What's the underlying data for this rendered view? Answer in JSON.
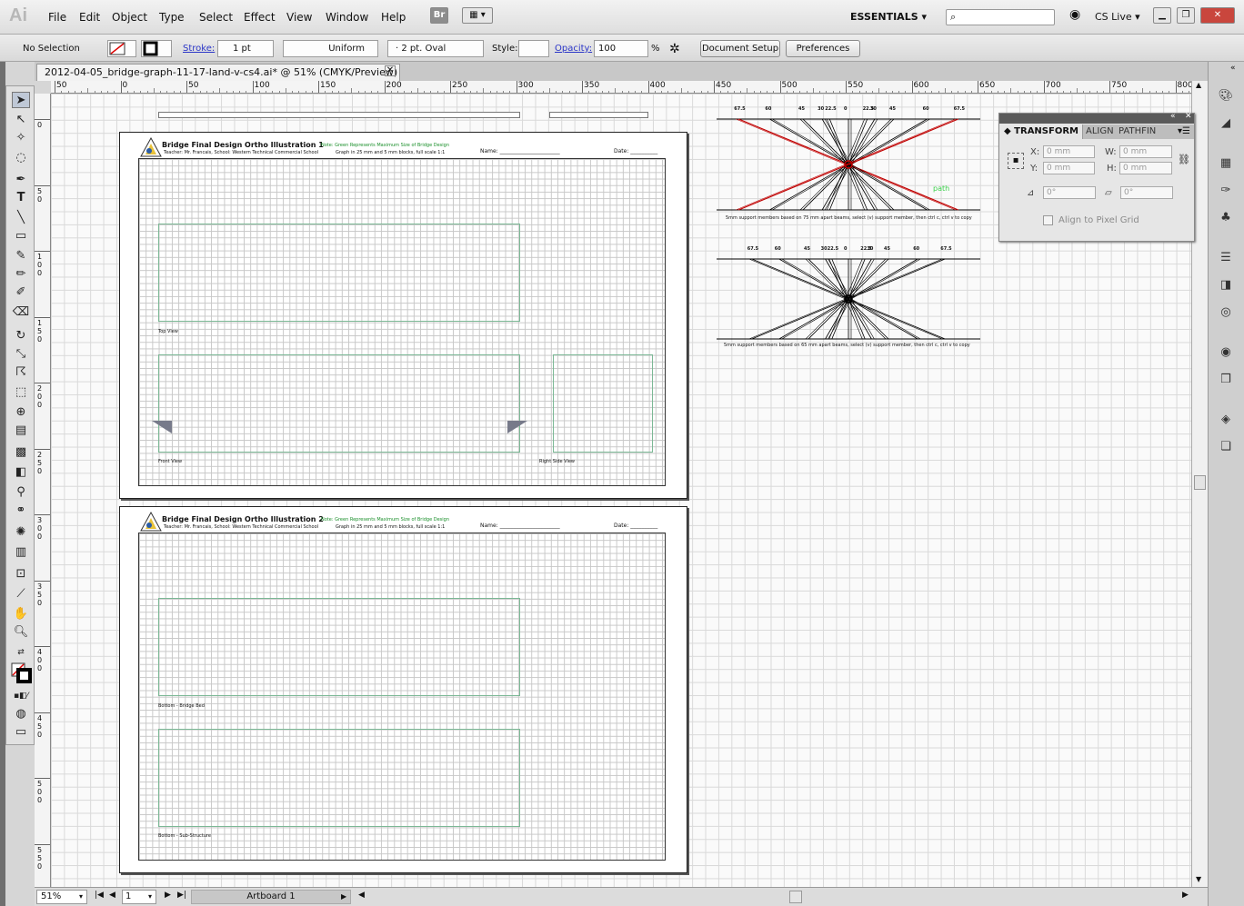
{
  "app": {
    "logo": "Ai"
  },
  "menu": {
    "items": [
      "File",
      "Edit",
      "Object",
      "Type",
      "Select",
      "Effect",
      "View",
      "Window",
      "Help"
    ],
    "bridge": "Br",
    "workspace": "ESSENTIALS",
    "cslive": "CS Live"
  },
  "control": {
    "selection": "No Selection",
    "stroke_label": "Stroke:",
    "stroke_weight": "1 pt",
    "stroke_profile": "Uniform",
    "brush": "2 pt. Oval",
    "style_label": "Style:",
    "opacity_label": "Opacity:",
    "opacity_value": "100",
    "percent": "%",
    "doc_setup": "Document Setup",
    "preferences": "Preferences"
  },
  "document": {
    "tab_title": "2012-04-05_bridge-graph-11-17-land-v-cs4.ai* @ 51% (CMYK/Preview)"
  },
  "rulers": {
    "h_ticks": [
      "50",
      "0",
      "50",
      "100",
      "150",
      "200",
      "250",
      "300",
      "350",
      "400",
      "450",
      "500",
      "550",
      "600",
      "650",
      "700",
      "750",
      "800"
    ],
    "v_ticks": [
      "0",
      "5 0",
      "1 0 0",
      "1 5 0",
      "2 0 0",
      "2 5 0",
      "3 0 0",
      "3 5 0",
      "4 0 0",
      "4 5 0",
      "5 0 0",
      "5 5 0"
    ]
  },
  "artboard1": {
    "title": "Bridge Final Design Ortho Illustration 1",
    "teacher": "Teacher: Mr. Francais,  School: Western Technical Commercial School",
    "note": "Note: Green Represents Maximum Size of Bridge Design",
    "graph": "Graph in 25 mm and 5 mm blocks, full scale 1:1",
    "name": "Name: ______________________",
    "date": "Date: __________",
    "top_view": "Top View",
    "front_view": "Front View",
    "right_view": "Right Side View"
  },
  "artboard2": {
    "title": "Bridge Final Design Ortho Illustration 2",
    "teacher": "Teacher: Mr. Francais,  School: Western Technical Commercial School",
    "note": "Note: Green Represents Maximum Size of Bridge Design",
    "graph": "Graph in 25 mm and 5 mm blocks, full scale 1:1",
    "name": "Name: ______________________",
    "date": "Date: __________",
    "bed": "Bottom - Bridge Bed",
    "sub": "Bottom - Sub-Structure"
  },
  "support1": {
    "angles": [
      "67.5",
      "60",
      "45",
      "30",
      "22.5",
      "0",
      "22.5",
      "30",
      "45",
      "60",
      "67.5"
    ],
    "caption": "5mm support members based on 75 mm apart beams, select (v) support member, then ctrl c, ctrl v to copy",
    "path_label": "path"
  },
  "support2": {
    "angles": [
      "67.5",
      "60",
      "45",
      "30",
      "22.5",
      "0",
      "22.5",
      "30",
      "45",
      "60",
      "67.5"
    ],
    "caption": "5mm support members based on 65 mm apart beams, select (v) support member, then ctrl c, ctrl v to copy"
  },
  "transform": {
    "tabs": [
      "TRANSFORM",
      "ALIGN",
      "PATHFIN"
    ],
    "x_label": "X:",
    "x": "0 mm",
    "y_label": "Y:",
    "y": "0 mm",
    "w_label": "W:",
    "w": "0 mm",
    "h_label": "H:",
    "h": "0 mm",
    "rotate": "0°",
    "shear": "0°",
    "pixel_grid": "Align to Pixel Grid"
  },
  "status": {
    "zoom": "51%",
    "page": "1",
    "artboard": "Artboard 1"
  }
}
